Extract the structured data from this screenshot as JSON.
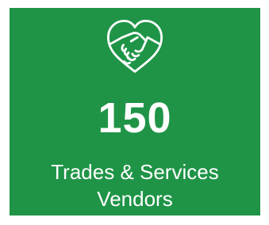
{
  "stat": {
    "count": "150",
    "label_line1": "Trades & Services",
    "label_line2": "Vendors",
    "icon": "heart-handshake-icon",
    "background_color": "#1f9447",
    "text_color": "#ffffff"
  }
}
